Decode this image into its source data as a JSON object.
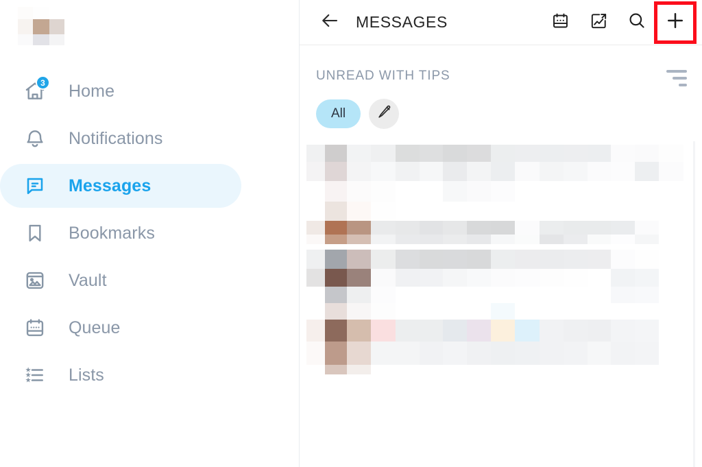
{
  "sidebar": {
    "logo_alt": "blurred-profile-logo",
    "items": [
      {
        "label": "Home",
        "icon": "home-icon",
        "badge": "3",
        "active": false
      },
      {
        "label": "Notifications",
        "icon": "bell-icon",
        "badge": "",
        "active": false
      },
      {
        "label": "Messages",
        "icon": "message-icon",
        "badge": "",
        "active": true
      },
      {
        "label": "Bookmarks",
        "icon": "bookmark-icon",
        "badge": "",
        "active": false
      },
      {
        "label": "Vault",
        "icon": "image-box-icon",
        "badge": "",
        "active": false
      },
      {
        "label": "Queue",
        "icon": "calendar-icon",
        "badge": "",
        "active": false
      },
      {
        "label": "Lists",
        "icon": "list-star-icon",
        "badge": "",
        "active": false
      }
    ]
  },
  "topbar": {
    "back_icon": "arrow-left-icon",
    "title": "MESSAGES",
    "actions": [
      {
        "icon": "calendar-icon",
        "name": "calendar-button",
        "highlighted": false
      },
      {
        "icon": "chart-image-icon",
        "name": "statistics-button",
        "highlighted": false
      },
      {
        "icon": "search-icon",
        "name": "search-button",
        "highlighted": false
      },
      {
        "icon": "plus-icon",
        "name": "new-message-button",
        "highlighted": true
      }
    ],
    "highlight_color": "#fc0d1b"
  },
  "list": {
    "section_title": "UNREAD WITH TIPS",
    "sort_icon": "sort-descending-icon",
    "filters": [
      {
        "label": "All",
        "type": "pill",
        "selected": true,
        "accent": "#b5e5f8"
      },
      {
        "label": "",
        "type": "icon",
        "icon": "pencil-icon",
        "selected": false
      }
    ],
    "conversations": [
      {
        "name": "conversation-row-1",
        "censored": true
      },
      {
        "name": "conversation-row-2",
        "censored": true
      },
      {
        "name": "conversation-row-3",
        "censored": true
      }
    ]
  },
  "colors": {
    "accent": "#1aa3ec",
    "accent_soft": "#eaf6fd",
    "muted_text": "#8a97a8",
    "badge": "#20a5e8",
    "pill": "#b5e5f8",
    "highlight": "#fc0d1b"
  }
}
